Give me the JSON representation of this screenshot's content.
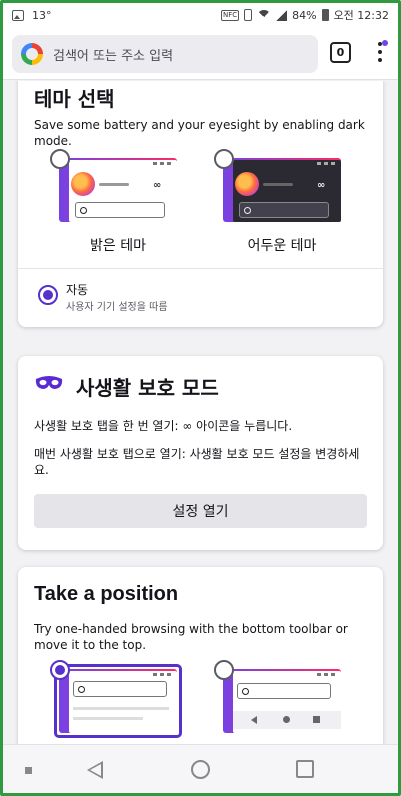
{
  "status_bar": {
    "temperature": "13°",
    "nfc_label": "NFC",
    "battery": "84%",
    "time": "오전 12:32"
  },
  "toolbar": {
    "url_placeholder": "검색어 또는 주소 입력",
    "tab_count": "0"
  },
  "theme_card": {
    "title": "테마 선택",
    "description": "Save some battery and your eyesight by enabling dark mode.",
    "light_label": "밝은 테마",
    "dark_label": "어두운 테마",
    "auto_label": "자동",
    "auto_sublabel": "사용자 기기 설정을 따름",
    "selected": "auto"
  },
  "private_card": {
    "title": "사생활 보호 모드",
    "line1": "사생활 보호 탭을 한 번 열기: ∞ 아이콘을 누릅니다.",
    "line2": "매번 사생활 보호 탭으로 열기: 사생활 보호 모드 설정을 변경하세요.",
    "button_label": "설정 열기"
  },
  "position_card": {
    "title": "Take a position",
    "description": "Try one-handed browsing with the bottom toolbar or move it to the top.",
    "selected": "top"
  },
  "colors": {
    "accent": "#5631cc",
    "gradient_start": "#7542e5",
    "gradient_end": "#ff2a67"
  }
}
